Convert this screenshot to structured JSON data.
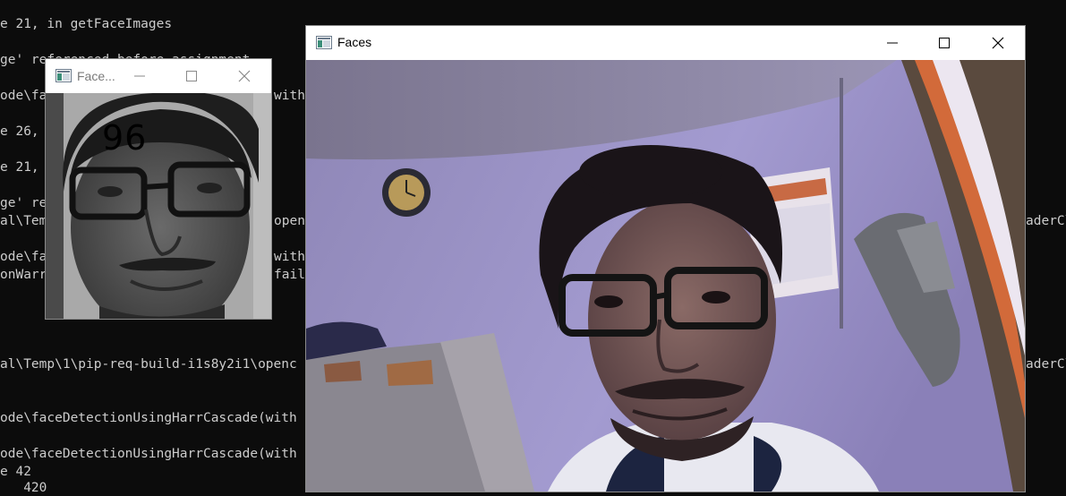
{
  "console": {
    "lines": [
      "e 21, in getFaceImages",
      "ge' referenced before assignment",
      "ode\\fa",
      "e 26,",
      "e 21,",
      "ge' re",
      "al\\Tem",
      "ode\\fa",
      "onWarr",
      "al\\Temp\\1\\pip-req-build-i1s8y2i1\\openc",
      "ode\\faceDetectionUsingHarrCascade(with",
      "ode\\faceDetectionUsingHarrCascade(with",
      "e 42",
      "   420"
    ],
    "between": [
      "with",
      "openc",
      "with",
      "fail"
    ],
    "right": [
      "aderCl",
      "aderCl"
    ]
  },
  "small_window": {
    "title": "Face...",
    "overlay_text": "96",
    "icons": {
      "app": "app-icon",
      "minimize": "minimize-icon",
      "maximize": "maximize-icon",
      "close": "close-icon"
    }
  },
  "big_window": {
    "title": "Faces",
    "icons": {
      "app": "app-icon",
      "minimize": "minimize-icon",
      "maximize": "maximize-icon",
      "close": "close-icon"
    }
  },
  "colors": {
    "console_bg": "#0c0c0c",
    "console_text": "#cccccc",
    "wall": "#9a90c8",
    "titlebar": "#ffffff"
  }
}
